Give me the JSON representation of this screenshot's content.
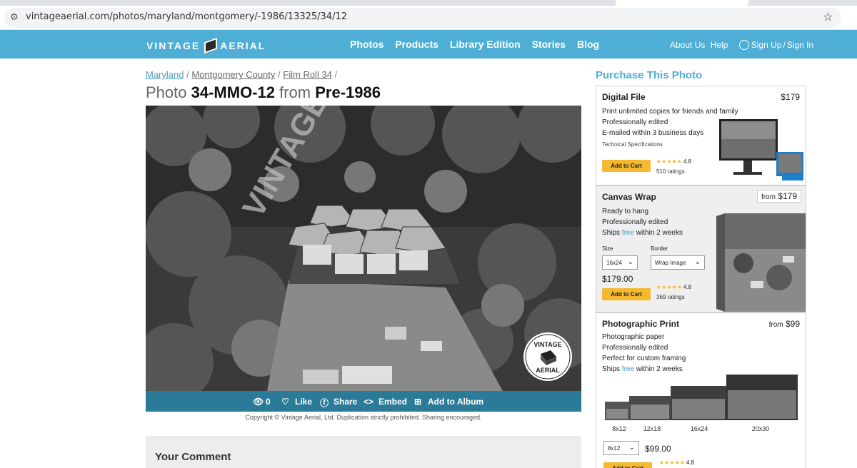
{
  "browser": {
    "url": "vintageaerial.com/photos/maryland/montgomery/-1986/13325/34/12",
    "icons": [
      "site-settings-icon",
      "bookmark-star-icon"
    ]
  },
  "header": {
    "logo_left": "VINTAGE",
    "logo_right": "AERIAL",
    "nav": [
      "Photos",
      "Products",
      "Library Edition",
      "Stories",
      "Blog"
    ],
    "about": "About Us",
    "help": "Help",
    "signup": "Sign Up",
    "slash": "/",
    "signin": "Sign In",
    "accent": "#4eaed6"
  },
  "breadcrumb": {
    "items": [
      "Maryland",
      "Montgomery County",
      "Film Roll 34"
    ],
    "sep": "/"
  },
  "title": {
    "prefix": "Photo",
    "code": "34-MMO-12",
    "mid": "from",
    "era": "Pre-1986"
  },
  "photo": {
    "watermark": "VINTAGE AERIAL",
    "badge_top": "VINTAGE",
    "badge_bottom": "AERIAL",
    "views": "0",
    "like": "Like",
    "share": "Share",
    "embed": "Embed",
    "album": "Add to Album",
    "bar_color": "#2a7a98"
  },
  "copyright": "Copyright © Vintage Aerial, Ltd. Duplication strictly prohibited. Sharing encouraged.",
  "comment": {
    "label": "Your Comment"
  },
  "purchase": {
    "title": "Purchase This Photo",
    "digital": {
      "name": "Digital File",
      "price": "$179",
      "features": [
        "Print unlimited copies for friends and family",
        "Professionally edited",
        "E-mailed within 3 business days"
      ],
      "tech": "Technical Specifications",
      "cart": "Add to Cart",
      "rating": "4.8",
      "ratings": "510 ratings"
    },
    "canvas": {
      "name": "Canvas Wrap",
      "from": "from",
      "price": "$179",
      "features": [
        "Ready to hang",
        "Professionally edited"
      ],
      "ships_a": "Ships",
      "ships_free": "free",
      "ships_b": "within 2 weeks",
      "size_label": "Size",
      "size_value": "16x24",
      "border_label": "Border",
      "border_value": "Wrap Image",
      "current_price": "$179.00",
      "cart": "Add to Cart",
      "rating": "4.8",
      "ratings": "369 ratings"
    },
    "print": {
      "name": "Photographic Print",
      "from": "from",
      "price": "$99",
      "features": [
        "Photographic paper",
        "Professionally edited",
        "Perfect for custom framing"
      ],
      "ships_a": "Ships",
      "ships_free": "free",
      "ships_b": "within 2 weeks",
      "sizes": [
        "8x12",
        "12x18",
        "16x24",
        "20x30"
      ],
      "size_value": "8x12",
      "current_price": "$99.00",
      "cart": "Add to Cart",
      "rating": "4.8"
    },
    "star_color": "#f5b82e"
  }
}
